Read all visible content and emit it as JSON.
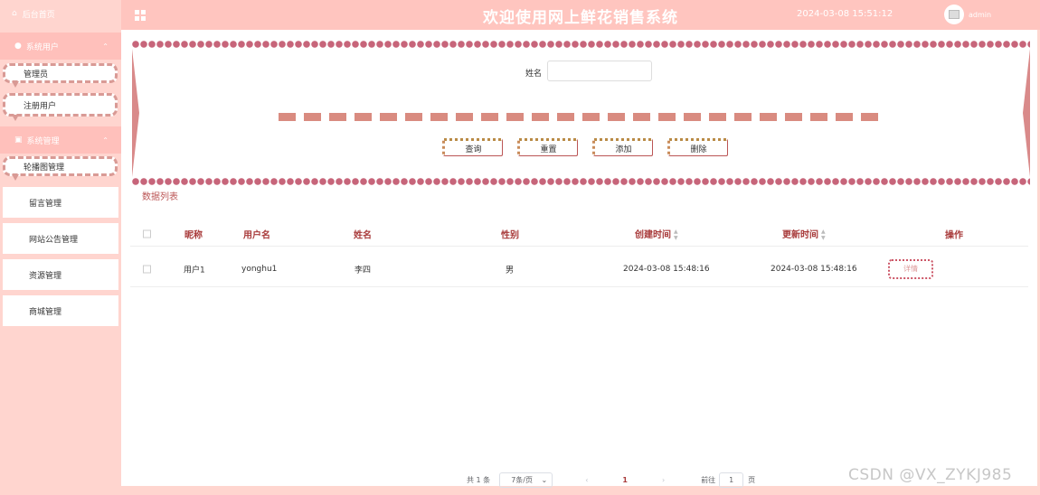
{
  "sidebar": {
    "home_label": "后台首页",
    "groups": [
      {
        "label": "系统用户",
        "icon": "user-icon",
        "items": [
          "管理员",
          "注册用户"
        ]
      },
      {
        "label": "系统管理",
        "icon": "image-icon",
        "items": [
          "轮播图管理",
          "留言管理",
          "网站公告管理",
          "资源管理",
          "商城管理"
        ]
      }
    ]
  },
  "header": {
    "title": "欢迎使用网上鲜花销售系统",
    "datetime": "2024-03-08 15:51:12",
    "username": "admin"
  },
  "search": {
    "name_label": "姓名",
    "name_value": "",
    "buttons": {
      "query": "查询",
      "reset": "重置",
      "add": "添加",
      "delete": "删除"
    }
  },
  "list": {
    "title": "数据列表",
    "columns": [
      "昵称",
      "用户名",
      "姓名",
      "性别",
      "创建时间",
      "更新时间",
      "操作"
    ],
    "rows": [
      {
        "nickname": "用户1",
        "username": "yonghu1",
        "name": "李四",
        "gender": "男",
        "created": "2024-03-08 15:48:16",
        "updated": "2024-03-08 15:48:16",
        "action": "详情"
      }
    ]
  },
  "pagination": {
    "total": "共 1 条",
    "page_size": "7条/页",
    "prev": "‹",
    "current": "1",
    "next": "›",
    "goto_label": "前往",
    "goto_value": "1",
    "page_suffix": "页"
  },
  "watermark": "CSDN @VX_ZYKJ985",
  "colors": {
    "accent": "#ffc5bf",
    "header_text": "#a83a3a",
    "border": "#c7657a"
  }
}
